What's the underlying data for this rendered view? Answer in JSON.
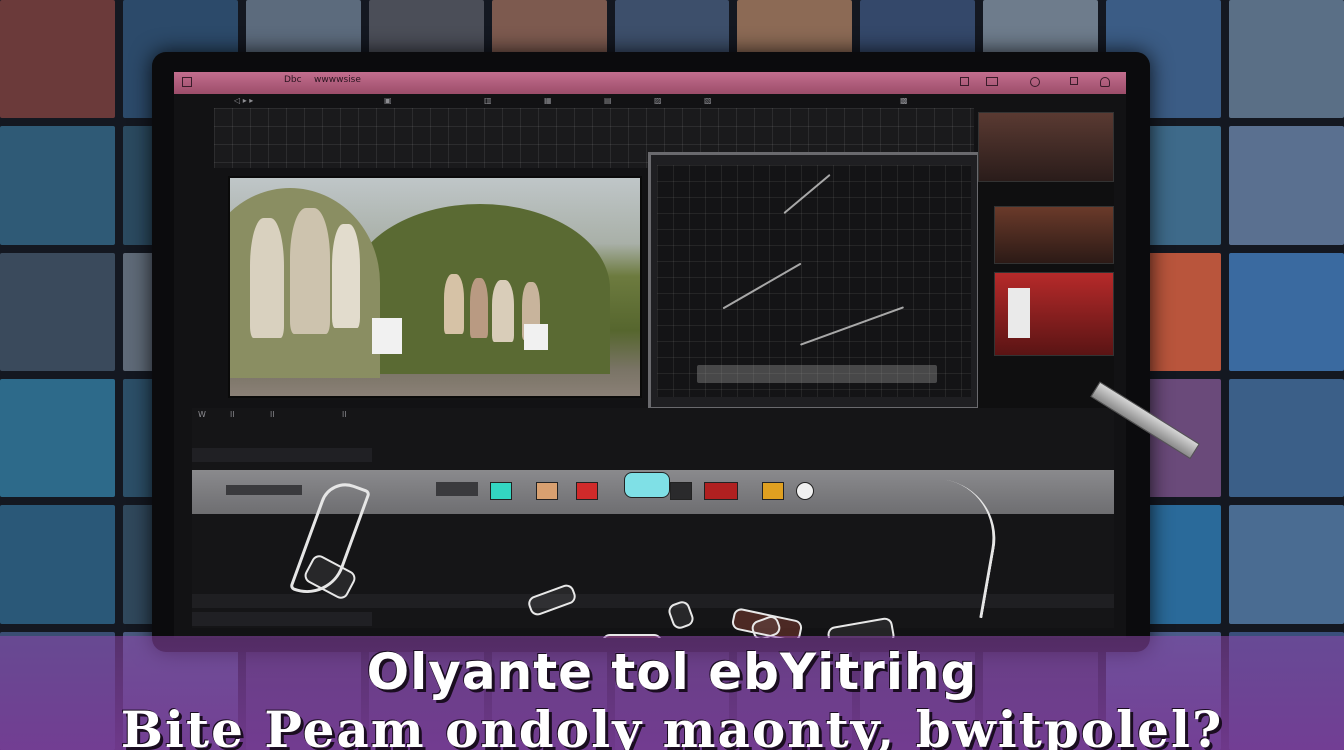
{
  "colors": {
    "background": "#141821",
    "title_bar": "#b35f7f",
    "caption_overlay": "#8a46aa",
    "timeline_band": "#7c7c7f",
    "caption_text": "#ffffff"
  },
  "topbar": {
    "menu_text": "Dbc",
    "menu_text2": "wwwwsise",
    "right_icons": [
      "window-icon",
      "monitor-icon",
      "wheel-icon",
      "expand-icon",
      "user-icon"
    ]
  },
  "timeline": {
    "ruler_marks": [
      "W",
      "ll",
      "ll",
      "ll"
    ],
    "tool_icons": [
      "cursor-icon",
      "text-icon",
      "crop-icon",
      "audio-icon",
      "effect-icon"
    ],
    "clip_colors": [
      "#33d6c2",
      "#d8a070",
      "#d02a2a",
      "#7fe0e6",
      "#b02020",
      "#e0a020",
      "#f0f0f0"
    ]
  },
  "caption": {
    "line1": "Olyante tol ebYitrihg",
    "line2": "Bite Peam ondoly maonty, bwitpolel?"
  }
}
